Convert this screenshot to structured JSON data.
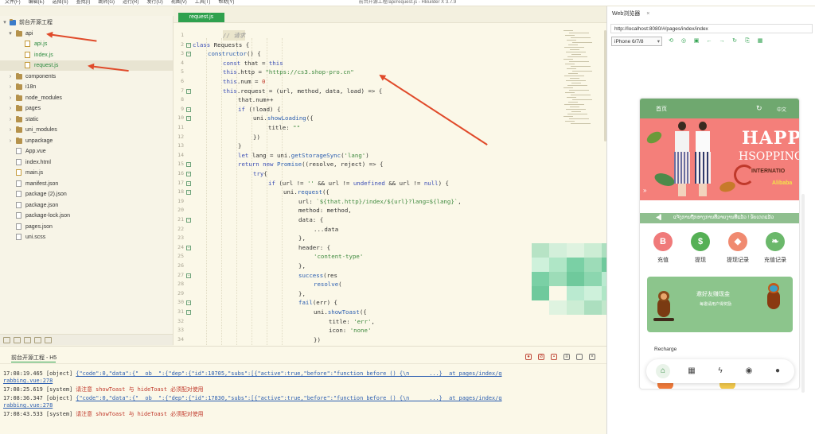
{
  "window": {
    "title": "前台开源工程/api/request.js - HBuilder X 3.7.9",
    "menus": [
      "文件(F)",
      "编辑(E)",
      "选择(S)",
      "查找(I)",
      "跳转(G)",
      "运行(R)",
      "发行(U)",
      "视图(V)",
      "工具(T)",
      "帮助(Y)"
    ]
  },
  "sidebar": {
    "items": [
      {
        "label": "前台开源工程",
        "type": "project",
        "indent": 0,
        "chevron": "▾"
      },
      {
        "label": "api",
        "type": "folder",
        "indent": 1,
        "chevron": "▾"
      },
      {
        "label": "api.js",
        "type": "file",
        "indent": 2
      },
      {
        "label": "index.js",
        "type": "file",
        "indent": 2
      },
      {
        "label": "request.js",
        "type": "file",
        "indent": 2,
        "selected": true
      },
      {
        "label": "components",
        "type": "folder",
        "indent": 1,
        "chevron": "›"
      },
      {
        "label": "i18n",
        "type": "folder",
        "indent": 1,
        "chevron": "›"
      },
      {
        "label": "node_modules",
        "type": "folder",
        "indent": 1,
        "chevron": "›"
      },
      {
        "label": "pages",
        "type": "folder",
        "indent": 1,
        "chevron": "›"
      },
      {
        "label": "static",
        "type": "folder",
        "indent": 1,
        "chevron": "›"
      },
      {
        "label": "uni_modules",
        "type": "folder",
        "indent": 1,
        "chevron": "›"
      },
      {
        "label": "unpackage",
        "type": "folder",
        "indent": 1,
        "chevron": "›"
      },
      {
        "label": "App.vue",
        "type": "file",
        "indent": 1
      },
      {
        "label": "index.html",
        "type": "file",
        "indent": 1
      },
      {
        "label": "main.js",
        "type": "file",
        "indent": 1
      },
      {
        "label": "manifest.json",
        "type": "file",
        "indent": 1
      },
      {
        "label": "package (2).json",
        "type": "file",
        "indent": 1
      },
      {
        "label": "package.json",
        "type": "file",
        "indent": 1
      },
      {
        "label": "package-lock.json",
        "type": "file",
        "indent": 1
      },
      {
        "label": "pages.json",
        "type": "file",
        "indent": 1
      },
      {
        "label": "uni.scss",
        "type": "file",
        "indent": 1
      }
    ]
  },
  "editor": {
    "tab_label": "request.js",
    "lines": [
      {
        "n": "1",
        "fold": "",
        "indent": 2,
        "parts": [
          [
            "cm",
            "// 请求"
          ]
        ],
        "comment": true
      },
      {
        "n": "2",
        "fold": "⊟",
        "indent": 0,
        "parts": [
          [
            "kw",
            "class "
          ],
          [
            "",
            "Requests {"
          ]
        ]
      },
      {
        "n": "3",
        "fold": "⊟",
        "indent": 1,
        "parts": [
          [
            "fn",
            "constructor"
          ],
          [
            "",
            "() {"
          ]
        ]
      },
      {
        "n": "4",
        "fold": "",
        "indent": 2,
        "parts": [
          [
            "kw",
            "const "
          ],
          [
            "",
            "that = "
          ],
          [
            "kw",
            "this"
          ]
        ]
      },
      {
        "n": "5",
        "fold": "",
        "indent": 2,
        "parts": [
          [
            "kw",
            "this"
          ],
          [
            "",
            ".http = "
          ],
          [
            "str",
            "\"https://cs3.shop-pro.cn\""
          ]
        ]
      },
      {
        "n": "6",
        "fold": "",
        "indent": 2,
        "parts": [
          [
            "kw",
            "this"
          ],
          [
            "",
            ".num = "
          ],
          [
            "num",
            "0"
          ]
        ]
      },
      {
        "n": "7",
        "fold": "⊟",
        "indent": 2,
        "parts": [
          [
            "kw",
            "this"
          ],
          [
            "",
            ".request = (url, method, data, load) => {"
          ]
        ]
      },
      {
        "n": "8",
        "fold": "",
        "indent": 3,
        "parts": [
          [
            "",
            "that.num++"
          ]
        ]
      },
      {
        "n": "9",
        "fold": "⊟",
        "indent": 3,
        "parts": [
          [
            "kw",
            "if "
          ],
          [
            "",
            "(!load) {"
          ]
        ]
      },
      {
        "n": "10",
        "fold": "⊟",
        "indent": 4,
        "parts": [
          [
            "",
            "uni."
          ],
          [
            "fn",
            "showLoading"
          ],
          [
            "",
            "({"
          ]
        ]
      },
      {
        "n": "11",
        "fold": "",
        "indent": 5,
        "parts": [
          [
            "",
            "title: "
          ],
          [
            "str",
            "\"\""
          ]
        ]
      },
      {
        "n": "12",
        "fold": "",
        "indent": 4,
        "parts": [
          [
            "",
            "})"
          ]
        ]
      },
      {
        "n": "13",
        "fold": "",
        "indent": 3,
        "parts": [
          [
            "",
            "}"
          ]
        ]
      },
      {
        "n": "14",
        "fold": "",
        "indent": 3,
        "parts": [
          [
            "kw",
            "let "
          ],
          [
            "",
            "lang = uni."
          ],
          [
            "fn",
            "getStorageSync"
          ],
          [
            "",
            "("
          ],
          [
            "str",
            "'lang'"
          ],
          [
            "",
            ")"
          ]
        ]
      },
      {
        "n": "15",
        "fold": "⊟",
        "indent": 3,
        "parts": [
          [
            "kw",
            "return new "
          ],
          [
            "fn",
            "Promise"
          ],
          [
            "",
            "((resolve, reject) => {"
          ]
        ]
      },
      {
        "n": "16",
        "fold": "⊟",
        "indent": 4,
        "parts": [
          [
            "kw",
            "try"
          ],
          [
            "",
            "{"
          ]
        ]
      },
      {
        "n": "17",
        "fold": "⊟",
        "indent": 5,
        "parts": [
          [
            "kw",
            "if "
          ],
          [
            "",
            "(url != "
          ],
          [
            "str",
            "''"
          ],
          [
            "",
            " && url != "
          ],
          [
            "kw",
            "undefined"
          ],
          [
            "",
            " && url != "
          ],
          [
            "kw",
            "null"
          ],
          [
            "",
            ") {"
          ]
        ]
      },
      {
        "n": "18",
        "fold": "⊟",
        "indent": 6,
        "parts": [
          [
            "",
            "uni."
          ],
          [
            "fn",
            "request"
          ],
          [
            "",
            "({"
          ]
        ]
      },
      {
        "n": "19",
        "fold": "",
        "indent": 7,
        "parts": [
          [
            "",
            "url: "
          ],
          [
            "str",
            "`${that.http}/index/${url}?lang=${lang}`"
          ],
          [
            "",
            ","
          ]
        ]
      },
      {
        "n": "20",
        "fold": "",
        "indent": 7,
        "parts": [
          [
            "",
            "method: method,"
          ]
        ]
      },
      {
        "n": "21",
        "fold": "⊟",
        "indent": 7,
        "parts": [
          [
            "",
            "data: {"
          ]
        ]
      },
      {
        "n": "22",
        "fold": "",
        "indent": 8,
        "parts": [
          [
            "",
            "...data"
          ]
        ]
      },
      {
        "n": "23",
        "fold": "",
        "indent": 7,
        "parts": [
          [
            "",
            "},"
          ]
        ]
      },
      {
        "n": "24",
        "fold": "⊟",
        "indent": 7,
        "parts": [
          [
            "",
            "header: {"
          ]
        ]
      },
      {
        "n": "25",
        "fold": "",
        "indent": 8,
        "parts": [
          [
            "str",
            "'content-type'"
          ]
        ]
      },
      {
        "n": "26",
        "fold": "",
        "indent": 7,
        "parts": [
          [
            "",
            "},"
          ]
        ]
      },
      {
        "n": "27",
        "fold": "⊟",
        "indent": 7,
        "parts": [
          [
            "fn",
            "success"
          ],
          [
            "",
            "(res"
          ]
        ]
      },
      {
        "n": "28",
        "fold": "",
        "indent": 8,
        "parts": [
          [
            "fn",
            "resolve"
          ],
          [
            "",
            "("
          ]
        ]
      },
      {
        "n": "29",
        "fold": "",
        "indent": 7,
        "parts": [
          [
            "",
            "},"
          ]
        ]
      },
      {
        "n": "30",
        "fold": "⊟",
        "indent": 7,
        "parts": [
          [
            "fn",
            "fail"
          ],
          [
            "",
            "(err) {"
          ]
        ]
      },
      {
        "n": "31",
        "fold": "⊟",
        "indent": 8,
        "parts": [
          [
            "",
            "uni."
          ],
          [
            "fn",
            "showToast"
          ],
          [
            "",
            "({"
          ]
        ]
      },
      {
        "n": "32",
        "fold": "",
        "indent": 9,
        "parts": [
          [
            "",
            "title: "
          ],
          [
            "str",
            "'err'"
          ],
          [
            "",
            ","
          ]
        ]
      },
      {
        "n": "33",
        "fold": "",
        "indent": 9,
        "parts": [
          [
            "",
            "icon: "
          ],
          [
            "str",
            "'none'"
          ]
        ]
      },
      {
        "n": "34",
        "fold": "",
        "indent": 8,
        "parts": [
          [
            "",
            "})"
          ]
        ]
      }
    ]
  },
  "console": {
    "title": "前台开源工程 - H5",
    "logs": [
      {
        "time": "17:08:19.465",
        "tag": "[object]",
        "body": "{\"code\":0,\"data\":{\"__ob__\":{\"dep\":{\"id\":10705,\"subs\":[{\"active\":true,\"before\":\"function before () {\\n      ...}",
        "kind": "json",
        "link": "at pages/index/g",
        "cont": "rabbing.vue:278"
      },
      {
        "time": "17:08:25.619",
        "tag": "[system]",
        "body": "请注意 showToast 与 hideToast 必须配对使用",
        "kind": "warn"
      },
      {
        "time": "17:08:36.347",
        "tag": "[object]",
        "body": "{\"code\":0,\"data\":{\"__ob__\":{\"dep\":{\"id\":17830,\"subs\":[{\"active\":true,\"before\":\"function before () {\\n      ...}",
        "kind": "json",
        "link": "at pages/index/g",
        "cont": "rabbing.vue:278"
      },
      {
        "time": "17:08:43.533",
        "tag": "[system]",
        "body": "请注意 showToast 与 hideToast 必须配对使用",
        "kind": "warn"
      }
    ]
  },
  "preview": {
    "tab_label": "Web浏览器",
    "close": "×",
    "url": "http://localhost:8080/#/pages/index/index",
    "device": "iPhone 6/7/8",
    "phone": {
      "header_title": "首页",
      "lang_label": "中文",
      "banner_big": "HAPP",
      "banner_shop": "HSOPPING",
      "banner_intl": "INTERNATIO",
      "banner_ali": "Alibaba",
      "notice_text": "ແຈ້ງການຖືກຮາງການທີ່ລາຍງານທີ່ແລ້ວ ! ອັບເດດແລ້ວ",
      "quick": [
        {
          "label": "充值",
          "glyph": "B",
          "color": "#f07a7a"
        },
        {
          "label": "提现",
          "glyph": "$",
          "color": "#55b055"
        },
        {
          "label": "提现记录",
          "glyph": "◆",
          "color": "#f08a70"
        },
        {
          "label": "充值记录",
          "glyph": "❧",
          "color": "#6bb86b"
        }
      ],
      "card_title": "邀好友赚现金",
      "card_sub": "每邀请用户得奖励",
      "recharge_label": "Recharge"
    }
  },
  "colors": {
    "accent": "#2fa14e",
    "phone_green": "#6fa86f",
    "banner": "#f47f7a",
    "arrow": "#e04a2a"
  }
}
